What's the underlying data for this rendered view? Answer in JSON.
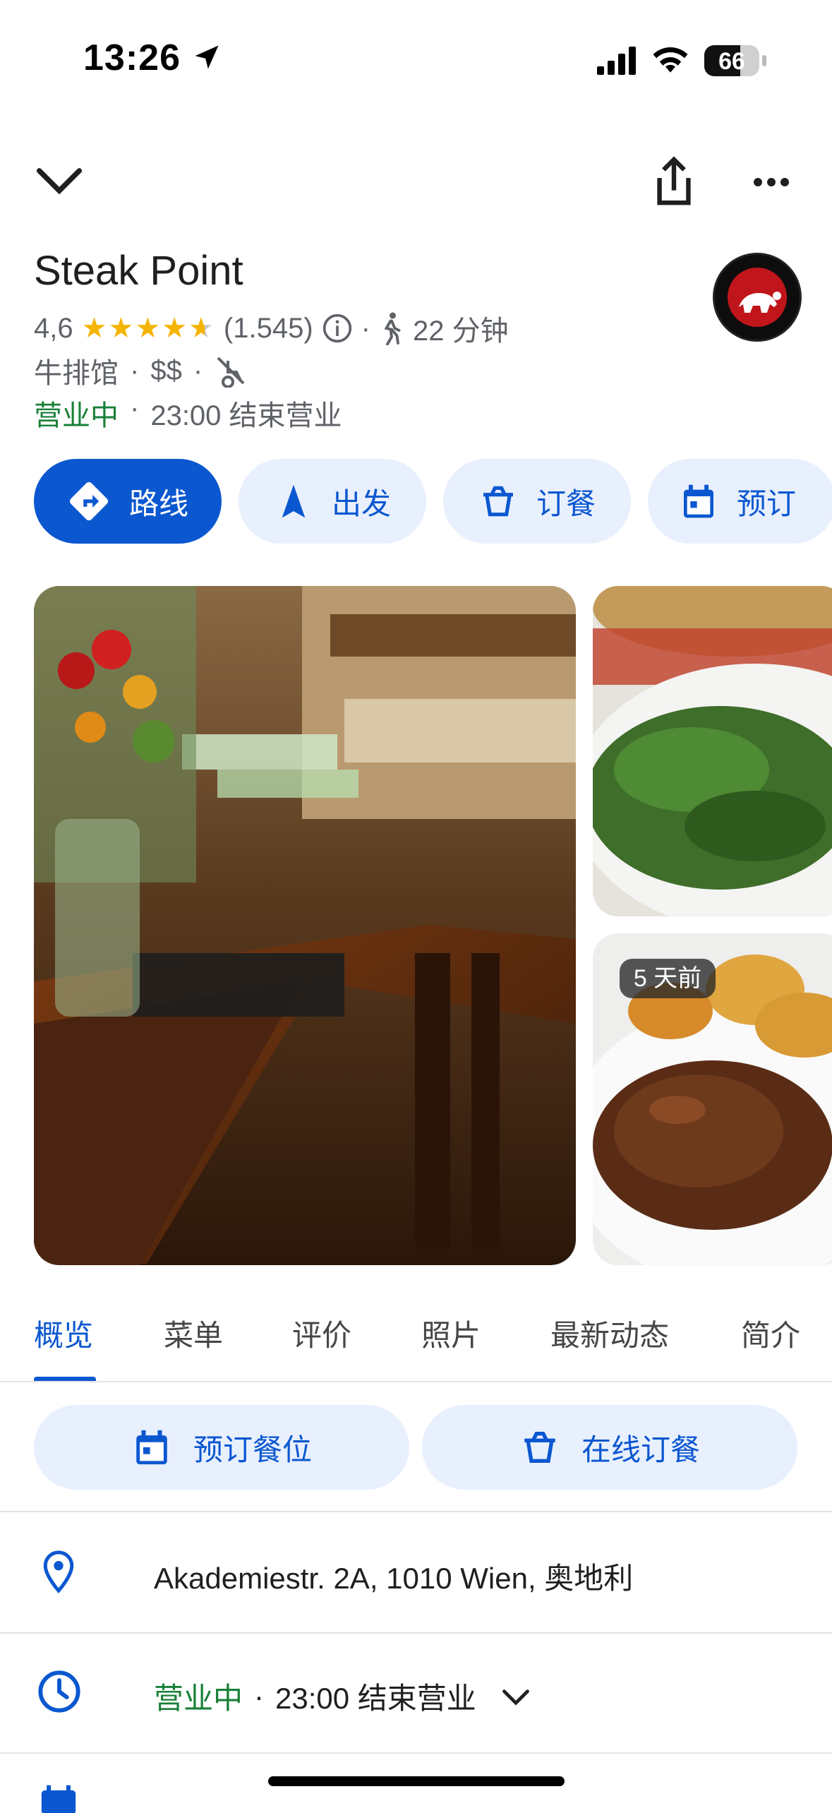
{
  "status_bar": {
    "time": "13:26",
    "battery": "66",
    "battery_level": 0.66
  },
  "place": {
    "name": "Steak Point",
    "rating": "4,6",
    "rating_value": 4.6,
    "reviews": "(1.545)",
    "walk_time": "22 分钟",
    "category": "牛排馆",
    "price": "$$",
    "open_status": "营业中",
    "hours": "23:00 结束营业",
    "separator": "·"
  },
  "actions": [
    {
      "label": "路线",
      "icon": "directions-icon"
    },
    {
      "label": "出发",
      "icon": "navigation-arrow-icon"
    },
    {
      "label": "订餐",
      "icon": "order-food-icon"
    },
    {
      "label": "预订",
      "icon": "calendar-icon"
    }
  ],
  "photos": {
    "badge": "5 天前"
  },
  "tabs": [
    "概览",
    "菜单",
    "评价",
    "照片",
    "最新动态",
    "简介"
  ],
  "quick_actions": {
    "reserve": "预订餐位",
    "order": "在线订餐"
  },
  "details": {
    "address": "Akademiestr. 2A, 1010 Wien, 奥地利",
    "open_status": "营业中",
    "hours": "23:00 结束营业",
    "separator": "·"
  },
  "colors": {
    "accent": "#0b57d0",
    "open": "#188038",
    "star": "#f4b400",
    "chip_bg": "#e8f0fe"
  }
}
